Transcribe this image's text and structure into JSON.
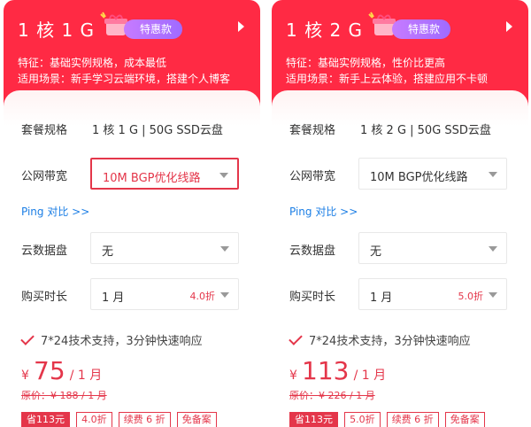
{
  "cards": [
    {
      "plan_name": "1 核 1 G",
      "promo_label": "特惠款",
      "feature_line": "特征：基础实例规格，成本最低",
      "scene_line": "适用场景：新手学习云端环境，搭建个人博客",
      "spec_label": "套餐规格",
      "spec_value": "1 核 1 G | 50G SSD云盘",
      "bandwidth_label": "公网带宽",
      "bandwidth_value": "10M BGP优化线路",
      "ping_link": "Ping 对比 >>",
      "disk_label": "云数据盘",
      "disk_value": "无",
      "duration_label": "购买时长",
      "duration_value": "1 月",
      "duration_discount": "4.0折",
      "support_text": "7*24技术支持，3分钟快速响应",
      "price_currency": "¥",
      "price_value": "75",
      "price_unit": "/ 1 月",
      "original_price": "原价：¥ 188 / 1 月",
      "tags": [
        "省113元",
        "4.0折",
        "续费 6 折",
        "免备案"
      ]
    },
    {
      "plan_name": "1 核 2 G",
      "promo_label": "特惠款",
      "feature_line": "特征：基础实例规格，性价比更高",
      "scene_line": "适用场景：新手上云体验，搭建应用不卡顿",
      "spec_label": "套餐规格",
      "spec_value": "1 核 2 G | 50G SSD云盘",
      "bandwidth_label": "公网带宽",
      "bandwidth_value": "10M BGP优化线路",
      "ping_link": "Ping 对比 >>",
      "disk_label": "云数据盘",
      "disk_value": "无",
      "duration_label": "购买时长",
      "duration_value": "1 月",
      "duration_discount": "5.0折",
      "support_text": "7*24技术支持，3分钟快速响应",
      "price_currency": "¥",
      "price_value": "113",
      "price_unit": "/ 1 月",
      "original_price": "原价：¥ 226 / 1 月",
      "tags": [
        "省113元",
        "5.0折",
        "续费 6 折",
        "免备案"
      ]
    }
  ],
  "colors": {
    "accent": "#ff2a44",
    "price": "#e4364a",
    "link": "#1b7ee5",
    "promo": "#a86bff"
  }
}
